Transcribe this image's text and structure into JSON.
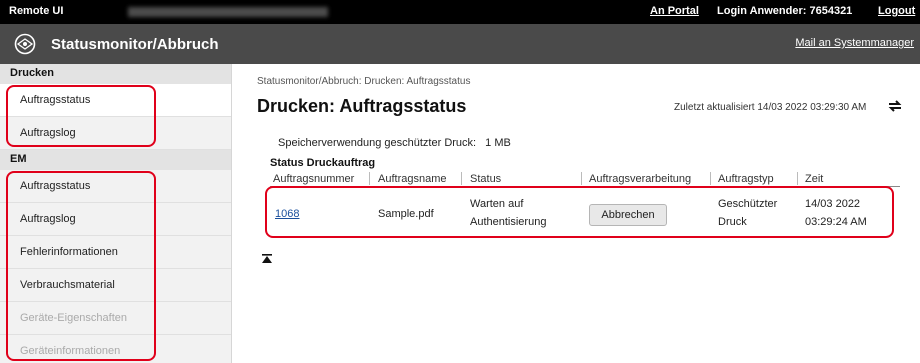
{
  "topbar": {
    "brand": "Remote UI",
    "portal_link": "An Portal",
    "login_text": "Login Anwender:  7654321",
    "logout_link": "Logout"
  },
  "titlebar": {
    "title": "Statusmonitor/Abbruch",
    "mail_link": "Mail an Systemmanager"
  },
  "sidebar": {
    "sections": [
      {
        "heading": "Drucken",
        "items": [
          {
            "label": "Auftragsstatus",
            "active": true,
            "disabled": false
          },
          {
            "label": "Auftragslog",
            "active": false,
            "disabled": false
          }
        ]
      },
      {
        "heading": "EM",
        "items": [
          {
            "label": "Auftragsstatus",
            "active": false,
            "disabled": false
          },
          {
            "label": "Auftragslog",
            "active": false,
            "disabled": false
          },
          {
            "label": "Fehlerinformationen",
            "active": false,
            "disabled": false
          },
          {
            "label": "Verbrauchsmaterial",
            "active": false,
            "disabled": false
          },
          {
            "label": "Geräte-Eigenschaften",
            "active": false,
            "disabled": true
          },
          {
            "label": "Geräteinformationen",
            "active": false,
            "disabled": true
          }
        ]
      }
    ]
  },
  "main": {
    "breadcrumb": "Statusmonitor/Abbruch: Drucken: Auftragsstatus",
    "page_title": "Drucken: Auftragsstatus",
    "last_updated": "Zuletzt aktualisiert 14/03 2022 03:29:30 AM",
    "storage_label": "Speicherverwendung geschützter Druck:",
    "storage_value": "1 MB",
    "status_heading": "Status Druckauftrag",
    "table": {
      "headers": [
        "Auftragsnummer",
        "Auftragsname",
        "Status",
        "Auftragsverarbeitung",
        "Auftragstyp",
        "Zeit"
      ],
      "rows": [
        {
          "number": "1068",
          "name": "Sample.pdf",
          "status_line1": "Warten auf",
          "status_line2": "Authentisierung",
          "action": "Abbrechen",
          "type_line1": "Geschützter",
          "type_line2": "Druck",
          "time_line1": "14/03 2022",
          "time_line2": "03:29:24 AM"
        }
      ]
    }
  },
  "colors": {
    "highlight": "#e0001a",
    "topbar": "#000000",
    "titlebar": "#4a4a4a",
    "link": "#1a4f9c"
  }
}
